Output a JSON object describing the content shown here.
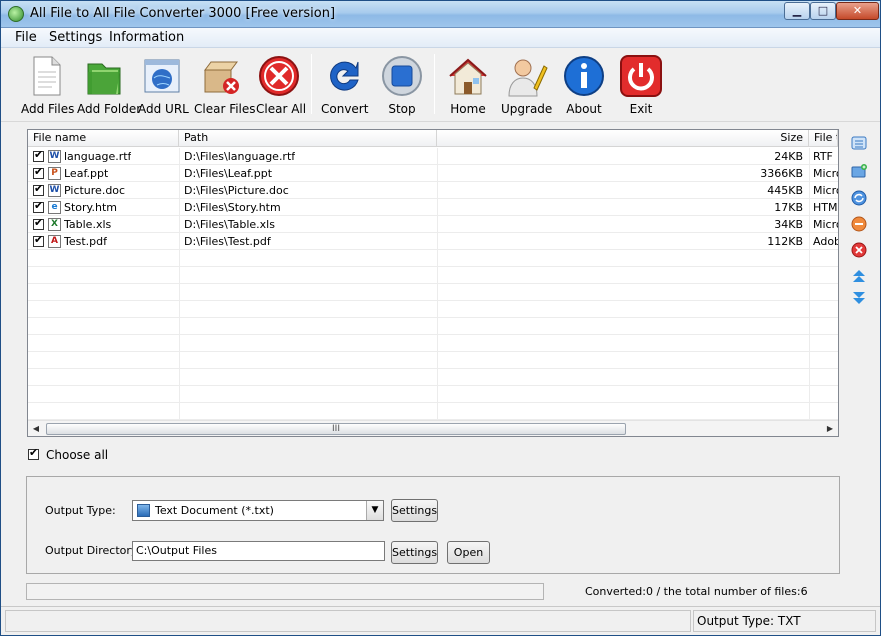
{
  "window": {
    "title": "All File to All File Converter 3000 [Free version]",
    "controls": {
      "minimize": "▁",
      "maximize": "□",
      "close": "✕"
    }
  },
  "menu": {
    "items": [
      {
        "label": "File"
      },
      {
        "label": "Settings"
      },
      {
        "label": "Information"
      }
    ]
  },
  "toolbar": {
    "buttons": [
      {
        "label": "Add Files",
        "icon": "document-icon"
      },
      {
        "label": "Add Folder",
        "icon": "folder-green-icon"
      },
      {
        "label": "Add URL",
        "icon": "web-page-icon"
      },
      {
        "label": "Clear Files",
        "icon": "box-delete-icon"
      },
      {
        "label": "Clear All",
        "icon": "red-x-icon"
      },
      {
        "label": "Convert",
        "icon": "convert-arrow-icon"
      },
      {
        "label": "Stop",
        "icon": "stop-icon"
      },
      {
        "label": "Home",
        "icon": "home-icon"
      },
      {
        "label": "Upgrade",
        "icon": "user-pen-icon"
      },
      {
        "label": "About",
        "icon": "info-icon"
      },
      {
        "label": "Exit",
        "icon": "power-icon"
      }
    ]
  },
  "file_list": {
    "columns": {
      "name": "File name",
      "path": "Path",
      "size": "Size",
      "type": "File t"
    },
    "rows": [
      {
        "checked": true,
        "icon": "W",
        "name": "language.rtf",
        "path": "D:\\Files\\language.rtf",
        "size": "24KB",
        "type": "RTF"
      },
      {
        "checked": true,
        "icon": "P",
        "name": "Leaf.ppt",
        "path": "D:\\Files\\Leaf.ppt",
        "size": "3366KB",
        "type": "Micro"
      },
      {
        "checked": true,
        "icon": "W",
        "name": "Picture.doc",
        "path": "D:\\Files\\Picture.doc",
        "size": "445KB",
        "type": "Micro"
      },
      {
        "checked": true,
        "icon": "e",
        "name": "Story.htm",
        "path": "D:\\Files\\Story.htm",
        "size": "17KB",
        "type": "HTM"
      },
      {
        "checked": true,
        "icon": "X",
        "name": "Table.xls",
        "path": "D:\\Files\\Table.xls",
        "size": "34KB",
        "type": "Micro"
      },
      {
        "checked": true,
        "icon": "A",
        "name": "Test.pdf",
        "path": "D:\\Files\\Test.pdf",
        "size": "112KB",
        "type": "Adob"
      }
    ],
    "scroll_grip": "III"
  },
  "side_icons": [
    "list-icon",
    "add-folder-icon",
    "refresh-icon",
    "remove-icon",
    "clear-icon",
    "move-top-icon",
    "move-bottom-icon"
  ],
  "choose_all": {
    "label": "Choose all",
    "checked": true
  },
  "output": {
    "type_label": "Output Type:",
    "type_value": "Text Document (*.txt)",
    "type_settings": "Settings",
    "dir_label": "Output Directory:",
    "dir_value": "C:\\Output Files",
    "dir_settings": "Settings",
    "open": "Open"
  },
  "progress": {
    "value": 0
  },
  "status": {
    "converted": "Converted:0  /  the total number of files:6",
    "output_type": "Output Type: TXT"
  }
}
